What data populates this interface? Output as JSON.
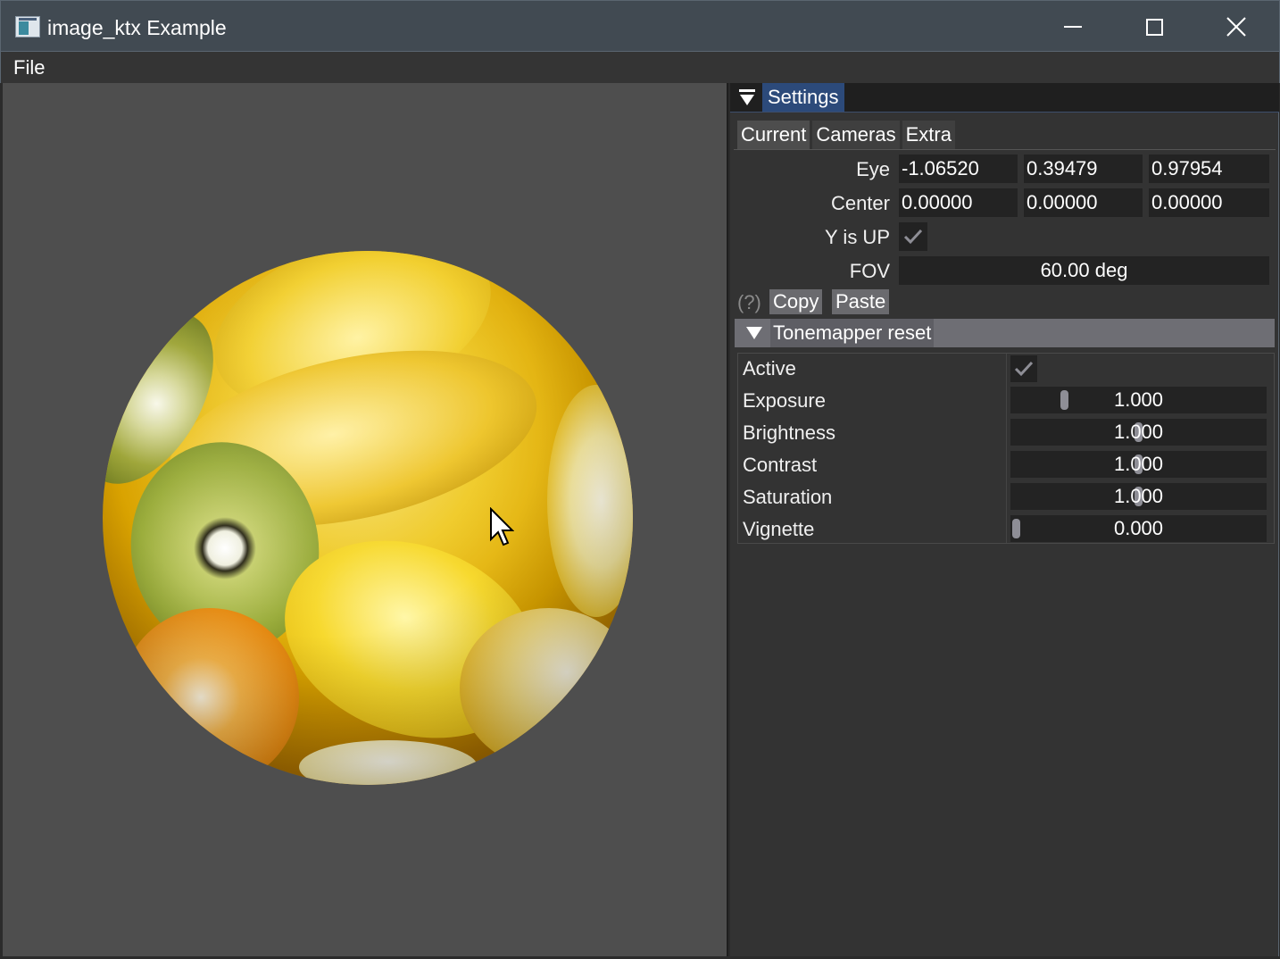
{
  "window": {
    "title": "image_ktx Example",
    "icon": "app-window-icon",
    "controls": [
      "minimize-icon",
      "maximize-icon",
      "close-icon"
    ]
  },
  "menu": {
    "file": "File"
  },
  "panel": {
    "title": "Settings",
    "tabs": [
      "Current",
      "Cameras",
      "Extra"
    ],
    "camera": {
      "eye_label": "Eye",
      "eye": [
        "-1.06520",
        "0.39479",
        "0.97954"
      ],
      "center_label": "Center",
      "center": [
        "0.00000",
        "0.00000",
        "0.00000"
      ],
      "y_up_label": "Y is UP",
      "y_up": true,
      "fov_label": "FOV",
      "fov": "60.00 deg",
      "help": "(?)",
      "copy": "Copy",
      "paste": "Paste"
    },
    "tonemapper": {
      "title": "Tonemapper reset",
      "active_label": "Active",
      "active": true,
      "sliders": [
        {
          "label": "Exposure",
          "value": "1.000"
        },
        {
          "label": "Brightness",
          "value": "1.000"
        },
        {
          "label": "Contrast",
          "value": "1.000"
        },
        {
          "label": "Saturation",
          "value": "1.000"
        },
        {
          "label": "Vignette",
          "value": "0.000"
        }
      ]
    }
  },
  "colors": {
    "accent": "#2c4a7a",
    "viewport_bg": "#4e4e4e",
    "panel_bg": "#333333"
  }
}
